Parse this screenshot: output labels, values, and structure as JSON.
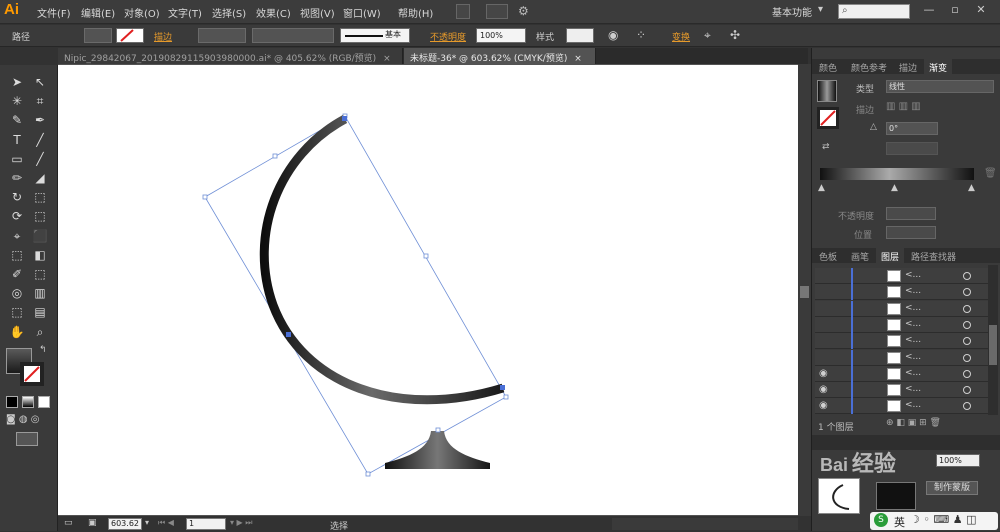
{
  "app": {
    "logo": "Ai",
    "menu": [
      "文件(F)",
      "编辑(E)",
      "对象(O)",
      "文字(T)",
      "选择(S)",
      "效果(C)",
      "视图(V)",
      "窗口(W)",
      "帮助(H)"
    ],
    "workspace": "基本功能",
    "search_placeholder": ""
  },
  "control": {
    "object_type": "路径",
    "stroke_label": "描边",
    "stroke_style": "基本",
    "opacity_label": "不透明度",
    "opacity_value": "100%",
    "style_label": "样式",
    "transform_label": "变换"
  },
  "tabs": [
    {
      "label": "Nipic_29842067_20190829115903980000.ai* @ 405.62% (RGB/预览)",
      "close": "×"
    },
    {
      "label": "未标题-36* @ 603.62% (CMYK/预览)",
      "close": "×"
    }
  ],
  "gradient_panel": {
    "tabs": [
      "颜色",
      "颜色参考",
      "描边",
      "渐变"
    ],
    "active_tab": "渐变",
    "type_label": "类型",
    "type_value": "线性",
    "stroke_label": "描边",
    "angle_value": "0°",
    "opacity_label": "不透明度",
    "location_label": "位置"
  },
  "layers_panel": {
    "tabs": [
      "色板",
      "画笔",
      "图层",
      "路径查找器"
    ],
    "active_tab": "图层",
    "rows": [
      {
        "name": "<...",
        "eye": false
      },
      {
        "name": "<...",
        "eye": false
      },
      {
        "name": "<...",
        "eye": false
      },
      {
        "name": "<...",
        "eye": false
      },
      {
        "name": "<...",
        "eye": false
      },
      {
        "name": "<...",
        "eye": false
      },
      {
        "name": "<...",
        "eye": true
      },
      {
        "name": "<...",
        "eye": true
      },
      {
        "name": "<...",
        "eye": true
      }
    ],
    "footer": "1 个图层"
  },
  "bottom_panel": {
    "opacity_value": "100%",
    "make_mask": "制作蒙版"
  },
  "status": {
    "zoom": "603.62",
    "page": "1",
    "tool_label": "选择"
  },
  "watermark": "经验",
  "ime": {
    "label": "英"
  },
  "colors": {
    "accent_orange": "#ff9a00",
    "link_orange": "#e69a2b",
    "selection_blue": "#4a6fd6"
  }
}
